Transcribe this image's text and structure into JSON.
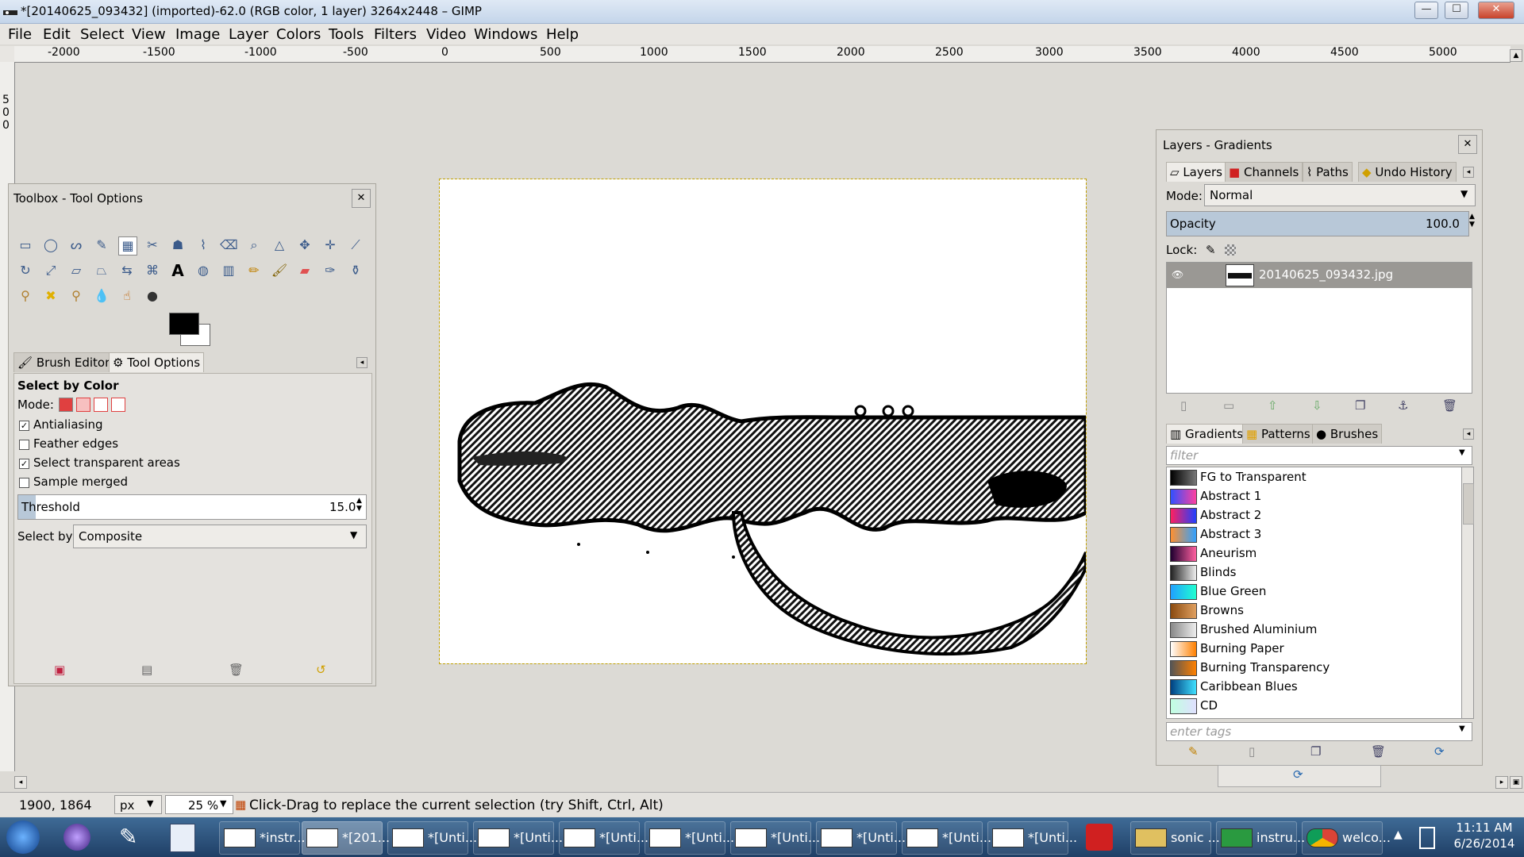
{
  "window": {
    "title": "*[20140625_093432] (imported)-62.0 (RGB color, 1 layer) 3264x2448 – GIMP",
    "minimize": "—",
    "maximize": "☐",
    "close": "✕"
  },
  "menubar": [
    "File",
    "Edit",
    "Select",
    "View",
    "Image",
    "Layer",
    "Colors",
    "Tools",
    "Filters",
    "Video",
    "Windows",
    "Help"
  ],
  "ruler": {
    "h_labels": [
      "-2000",
      "-1500",
      "-1000",
      "-500",
      "0",
      "500",
      "1000",
      "1500",
      "2000",
      "2500",
      "3000",
      "3500",
      "4000",
      "4500",
      "5000"
    ],
    "v_labels": [
      "5",
      "0",
      "0"
    ]
  },
  "toolbox": {
    "title": "Toolbox - Tool Options",
    "tabs": [
      "Brush Editor",
      "Tool Options"
    ],
    "tool_options": {
      "heading": "Select by Color",
      "mode_label": "Mode:",
      "antialiasing": "Antialiasing",
      "antialiasing_checked": true,
      "feather": "Feather edges",
      "feather_checked": false,
      "select_transparent": "Select transparent areas",
      "select_transparent_checked": true,
      "sample_merged": "Sample merged",
      "sample_merged_checked": false,
      "threshold_label": "Threshold",
      "threshold_value": "15.0",
      "select_by_label": "Select by:",
      "select_by_value": "Composite"
    }
  },
  "layers_dock": {
    "title": "Layers - Gradients",
    "tabs": [
      "Layers",
      "Channels",
      "Paths",
      "Undo History"
    ],
    "mode_label": "Mode:",
    "mode_value": "Normal",
    "opacity_label": "Opacity",
    "opacity_value": "100.0",
    "lock_label": "Lock:",
    "layer_name": "20140625_093432.jpg",
    "gradient_tabs": [
      "Gradients",
      "Patterns",
      "Brushes"
    ],
    "filter_placeholder": "filter",
    "tags_placeholder": "enter tags",
    "gradients": [
      {
        "name": "FG to Transparent",
        "colors": [
          "#000",
          "#777"
        ]
      },
      {
        "name": "Abstract 1",
        "colors": [
          "#3050ff",
          "#ff40a0"
        ]
      },
      {
        "name": "Abstract 2",
        "colors": [
          "#ff2060",
          "#2040ff"
        ]
      },
      {
        "name": "Abstract 3",
        "colors": [
          "#ff9030",
          "#30a0ff"
        ]
      },
      {
        "name": "Aneurism",
        "colors": [
          "#200030",
          "#ff60a0"
        ]
      },
      {
        "name": "Blinds",
        "colors": [
          "#222",
          "#eee"
        ]
      },
      {
        "name": "Blue Green",
        "colors": [
          "#20a0ff",
          "#20ffd0"
        ]
      },
      {
        "name": "Browns",
        "colors": [
          "#8a4a10",
          "#e0a060"
        ]
      },
      {
        "name": "Brushed Aluminium",
        "colors": [
          "#888",
          "#eee"
        ]
      },
      {
        "name": "Burning Paper",
        "colors": [
          "#fff",
          "#ff8000"
        ]
      },
      {
        "name": "Burning Transparency",
        "colors": [
          "#555",
          "#ff8000"
        ]
      },
      {
        "name": "Caribbean Blues",
        "colors": [
          "#004080",
          "#40e0ff"
        ]
      },
      {
        "name": "CD",
        "colors": [
          "#c0ffe0",
          "#e0e0ff"
        ]
      }
    ]
  },
  "statusbar": {
    "coords": "1900, 1864",
    "unit": "px",
    "zoom": "25 %",
    "message": "Click-Drag to replace the current selection (try Shift, Ctrl, Alt)"
  },
  "taskbar": {
    "items": [
      "*instr...",
      "*[201...",
      "*[Unti...",
      "*[Unti...",
      "*[Unti...",
      "*[Unti...",
      "*[Unti...",
      "*[Unti...",
      "*[Unti...",
      "*[Unti..."
    ],
    "right_items": [
      "sonic ...",
      "instru...",
      "welco..."
    ],
    "time": "11:11 AM",
    "date": "6/26/2014"
  }
}
